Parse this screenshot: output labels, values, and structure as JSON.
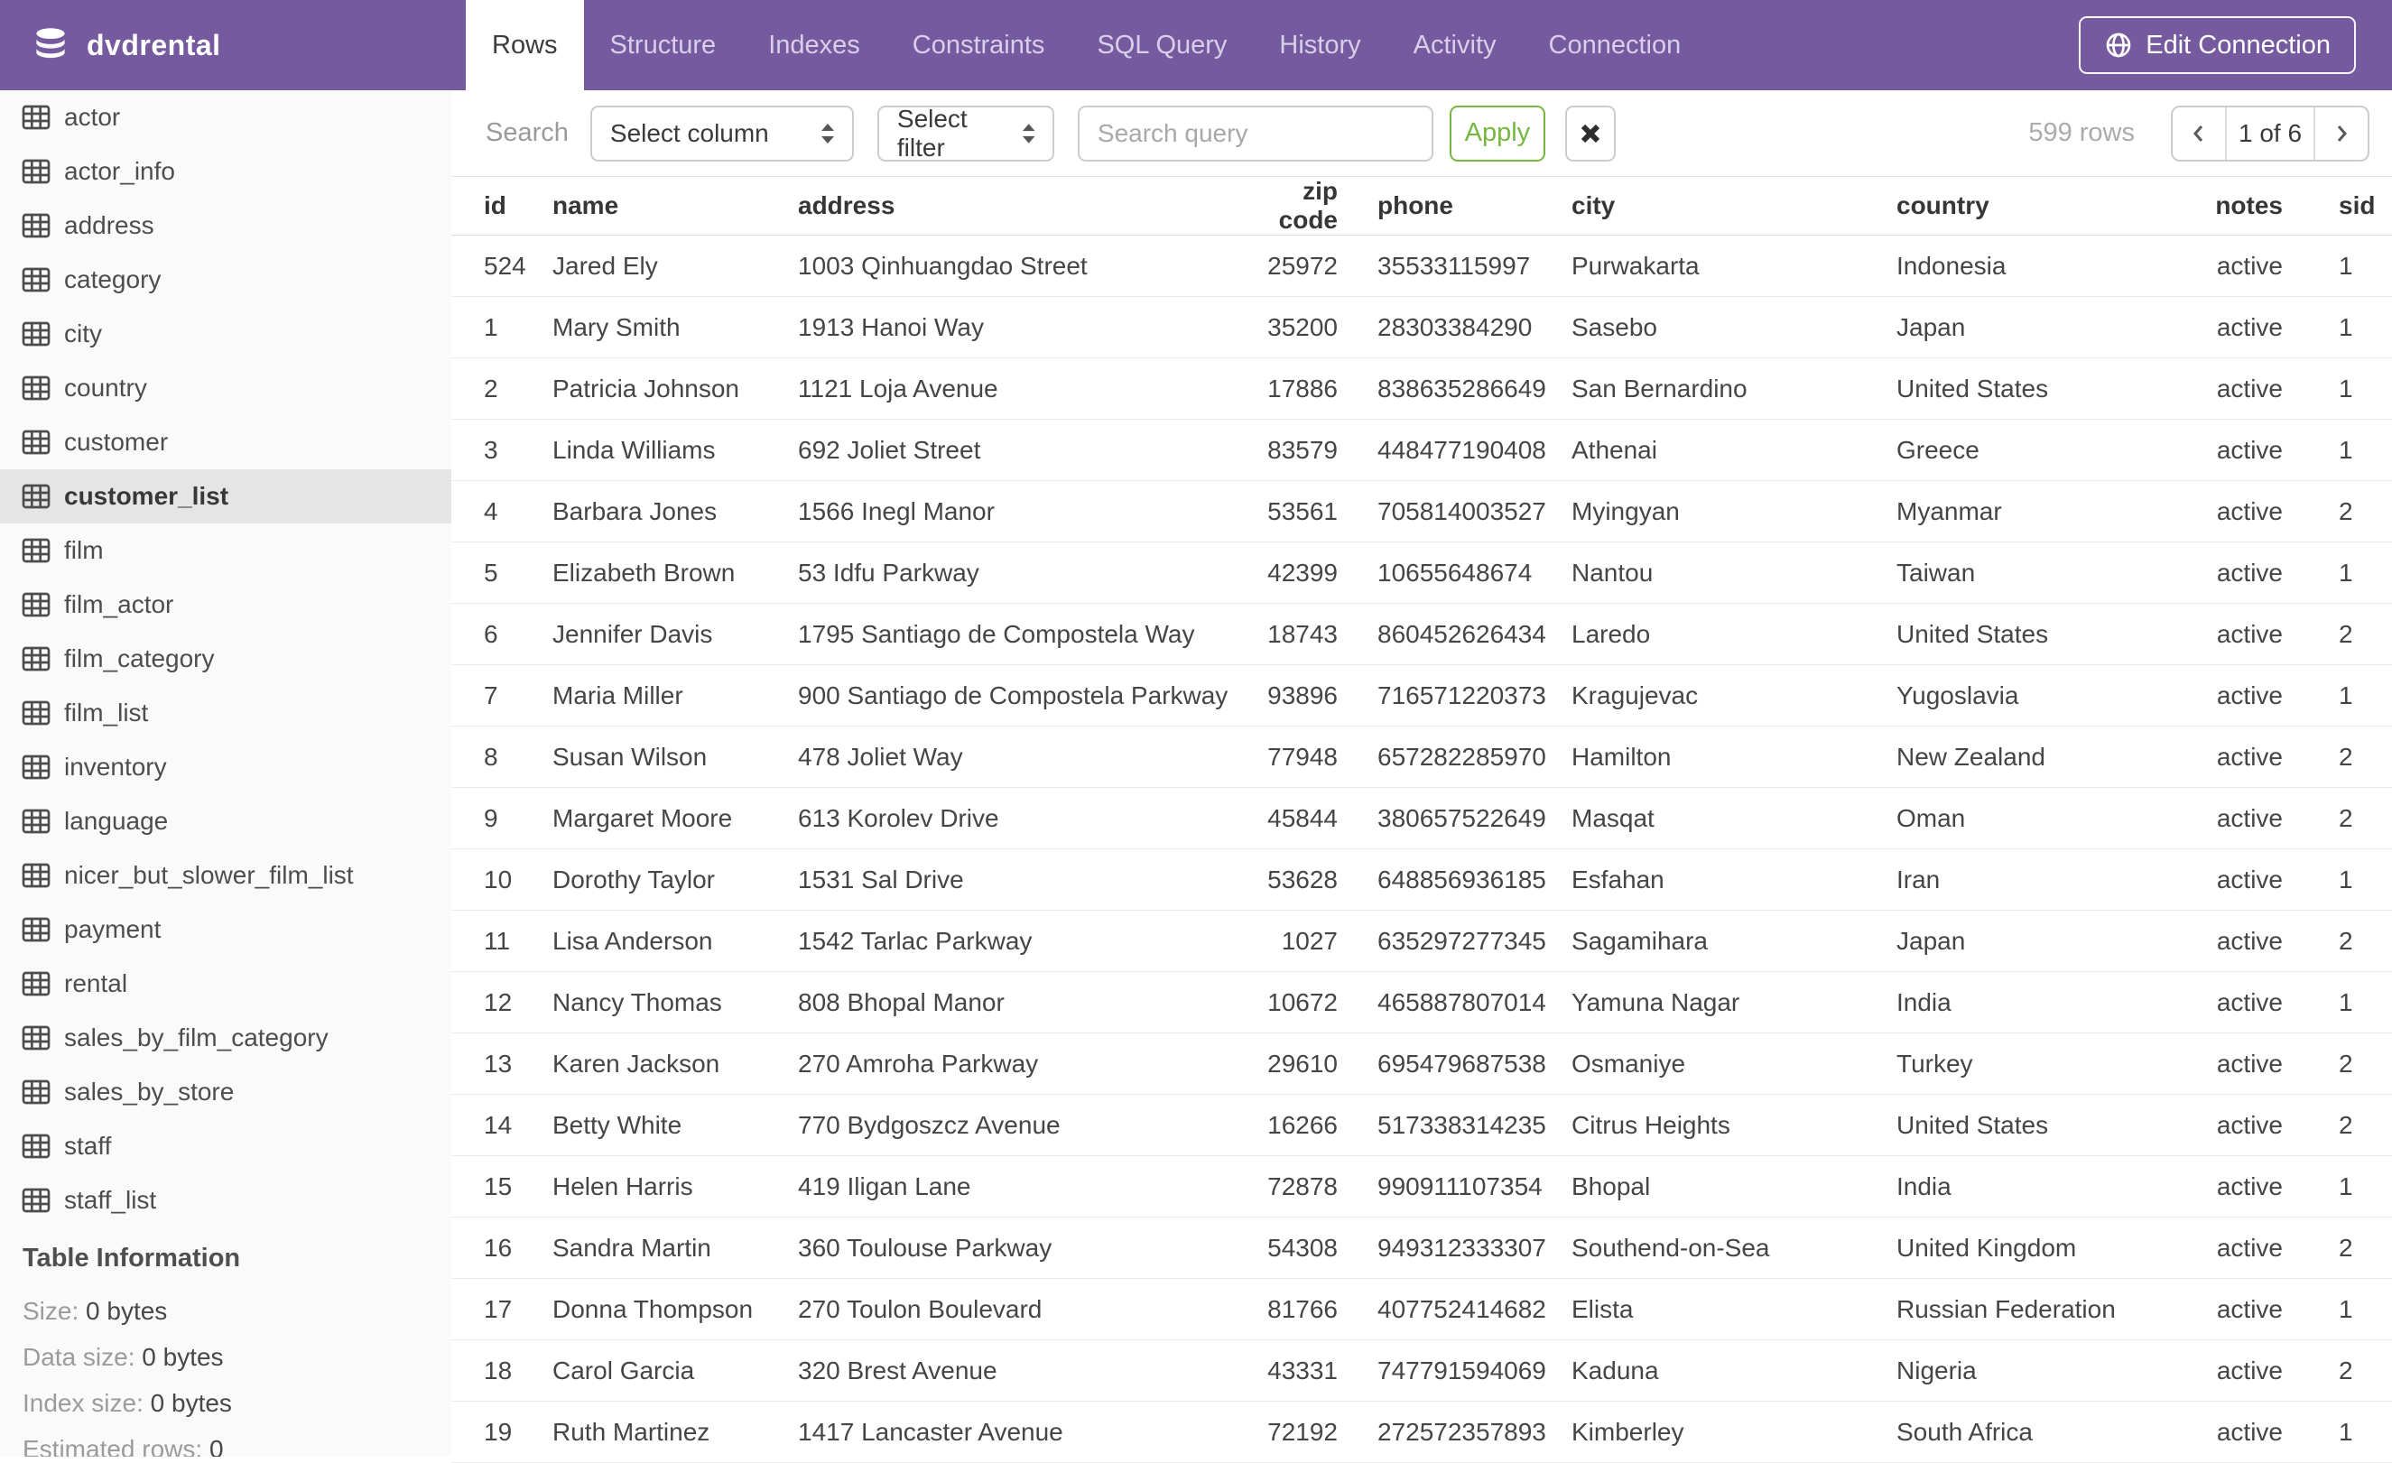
{
  "header": {
    "database_name": "dvdrental",
    "tabs": [
      {
        "label": "Rows",
        "active": true
      },
      {
        "label": "Structure",
        "active": false
      },
      {
        "label": "Indexes",
        "active": false
      },
      {
        "label": "Constraints",
        "active": false
      },
      {
        "label": "SQL Query",
        "active": false
      },
      {
        "label": "History",
        "active": false
      },
      {
        "label": "Activity",
        "active": false
      },
      {
        "label": "Connection",
        "active": false
      }
    ],
    "edit_connection_label": "Edit Connection"
  },
  "sidebar": {
    "tables": [
      "actor",
      "actor_info",
      "address",
      "category",
      "city",
      "country",
      "customer",
      "customer_list",
      "film",
      "film_actor",
      "film_category",
      "film_list",
      "inventory",
      "language",
      "nicer_but_slower_film_list",
      "payment",
      "rental",
      "sales_by_film_category",
      "sales_by_store",
      "staff",
      "staff_list"
    ],
    "selected_table": "customer_list",
    "table_information": {
      "title": "Table Information",
      "rows": [
        {
          "label": "Size:",
          "value": "0 bytes"
        },
        {
          "label": "Data size:",
          "value": "0 bytes"
        },
        {
          "label": "Index size:",
          "value": "0 bytes"
        },
        {
          "label": "Estimated rows:",
          "value": "0"
        }
      ]
    }
  },
  "toolbar": {
    "search_label": "Search",
    "column_select_value": "Select column",
    "filter_select_value": "Select filter",
    "query_placeholder": "Search query",
    "query_value": "",
    "apply_label": "Apply",
    "row_count": "599 rows",
    "pagination": {
      "current": "1 of 6"
    }
  },
  "table": {
    "columns": [
      {
        "key": "id",
        "label": "id",
        "align": "left"
      },
      {
        "key": "name",
        "label": "name",
        "align": "left"
      },
      {
        "key": "address",
        "label": "address",
        "align": "left"
      },
      {
        "key": "zip_code",
        "label": "zip code",
        "align": "right"
      },
      {
        "key": "phone",
        "label": "phone",
        "align": "left"
      },
      {
        "key": "city",
        "label": "city",
        "align": "left"
      },
      {
        "key": "country",
        "label": "country",
        "align": "left"
      },
      {
        "key": "notes",
        "label": "notes",
        "align": "right"
      },
      {
        "key": "sid",
        "label": "sid",
        "align": "left"
      }
    ],
    "rows": [
      [
        "524",
        "Jared Ely",
        "1003 Qinhuangdao Street",
        "25972",
        "35533115997",
        "Purwakarta",
        "Indonesia",
        "active",
        "1"
      ],
      [
        "1",
        "Mary Smith",
        "1913 Hanoi Way",
        "35200",
        "28303384290",
        "Sasebo",
        "Japan",
        "active",
        "1"
      ],
      [
        "2",
        "Patricia Johnson",
        "1121 Loja Avenue",
        "17886",
        "838635286649",
        "San Bernardino",
        "United States",
        "active",
        "1"
      ],
      [
        "3",
        "Linda Williams",
        "692 Joliet Street",
        "83579",
        "448477190408",
        "Athenai",
        "Greece",
        "active",
        "1"
      ],
      [
        "4",
        "Barbara Jones",
        "1566 Inegl Manor",
        "53561",
        "705814003527",
        "Myingyan",
        "Myanmar",
        "active",
        "2"
      ],
      [
        "5",
        "Elizabeth Brown",
        "53 Idfu Parkway",
        "42399",
        "10655648674",
        "Nantou",
        "Taiwan",
        "active",
        "1"
      ],
      [
        "6",
        "Jennifer Davis",
        "1795 Santiago de Compostela Way",
        "18743",
        "860452626434",
        "Laredo",
        "United States",
        "active",
        "2"
      ],
      [
        "7",
        "Maria Miller",
        "900 Santiago de Compostela Parkway",
        "93896",
        "716571220373",
        "Kragujevac",
        "Yugoslavia",
        "active",
        "1"
      ],
      [
        "8",
        "Susan Wilson",
        "478 Joliet Way",
        "77948",
        "657282285970",
        "Hamilton",
        "New Zealand",
        "active",
        "2"
      ],
      [
        "9",
        "Margaret Moore",
        "613 Korolev Drive",
        "45844",
        "380657522649",
        "Masqat",
        "Oman",
        "active",
        "2"
      ],
      [
        "10",
        "Dorothy Taylor",
        "1531 Sal Drive",
        "53628",
        "648856936185",
        "Esfahan",
        "Iran",
        "active",
        "1"
      ],
      [
        "11",
        "Lisa Anderson",
        "1542 Tarlac Parkway",
        "1027",
        "635297277345",
        "Sagamihara",
        "Japan",
        "active",
        "2"
      ],
      [
        "12",
        "Nancy Thomas",
        "808 Bhopal Manor",
        "10672",
        "465887807014",
        "Yamuna Nagar",
        "India",
        "active",
        "1"
      ],
      [
        "13",
        "Karen Jackson",
        "270 Amroha Parkway",
        "29610",
        "695479687538",
        "Osmaniye",
        "Turkey",
        "active",
        "2"
      ],
      [
        "14",
        "Betty White",
        "770 Bydgoszcz Avenue",
        "16266",
        "517338314235",
        "Citrus Heights",
        "United States",
        "active",
        "2"
      ],
      [
        "15",
        "Helen Harris",
        "419 Iligan Lane",
        "72878",
        "990911107354",
        "Bhopal",
        "India",
        "active",
        "1"
      ],
      [
        "16",
        "Sandra Martin",
        "360 Toulouse Parkway",
        "54308",
        "949312333307",
        "Southend-on-Sea",
        "United Kingdom",
        "active",
        "2"
      ],
      [
        "17",
        "Donna Thompson",
        "270 Toulon Boulevard",
        "81766",
        "407752414682",
        "Elista",
        "Russian Federation",
        "active",
        "1"
      ],
      [
        "18",
        "Carol Garcia",
        "320 Brest Avenue",
        "43331",
        "747791594069",
        "Kaduna",
        "Nigeria",
        "active",
        "2"
      ],
      [
        "19",
        "Ruth Martinez",
        "1417 Lancaster Avenue",
        "72192",
        "272572357893",
        "Kimberley",
        "South Africa",
        "active",
        "1"
      ]
    ]
  },
  "colors": {
    "header_purple": "#755AA0",
    "active_tab_bg": "#FFFFFF",
    "apply_green": "#77B73F",
    "sidebar_bg": "#FAFAFA",
    "selected_item_bg": "#E5E5E5"
  }
}
